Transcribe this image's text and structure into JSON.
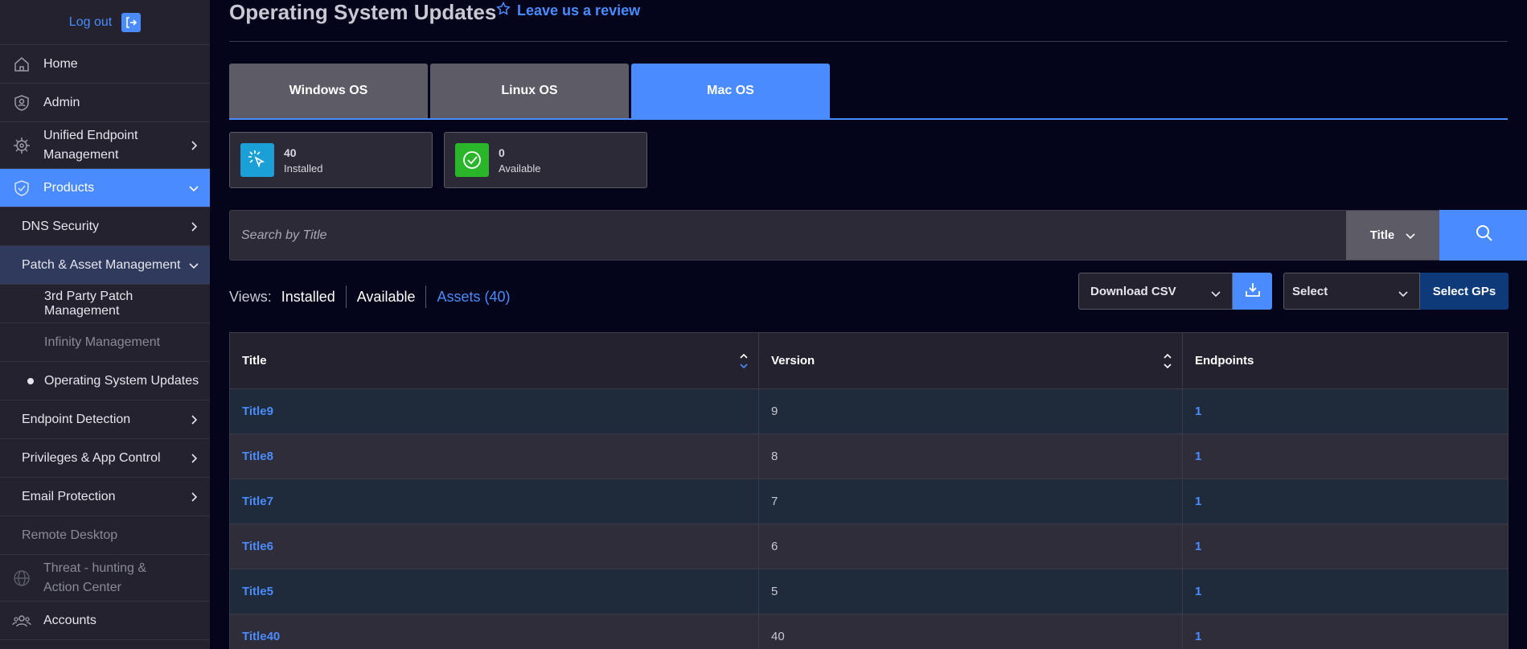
{
  "sidebar": {
    "logout_label": "Log out",
    "items": [
      {
        "label": "Home",
        "icon": "home-icon"
      },
      {
        "label": "Admin",
        "icon": "admin-icon"
      },
      {
        "label": "Unified Endpoint Management",
        "icon": "gear-icon"
      },
      {
        "label": "Products",
        "icon": "shield-icon"
      },
      {
        "label": "DNS Security"
      },
      {
        "label": "Patch & Asset Management"
      },
      {
        "label": "3rd Party Patch Management"
      },
      {
        "label": "Infinity Management"
      },
      {
        "label": "Operating System Updates"
      },
      {
        "label": "Endpoint Detection"
      },
      {
        "label": "Privileges & App Control"
      },
      {
        "label": "Email Protection"
      },
      {
        "label": "Remote Desktop"
      },
      {
        "label": "Threat - hunting & Action Center",
        "icon": "globe-icon"
      },
      {
        "label": "Accounts",
        "icon": "users-icon"
      }
    ]
  },
  "header": {
    "title": "Operating System Updates",
    "review_label": "Leave us a review"
  },
  "tabs": [
    {
      "label": "Windows OS"
    },
    {
      "label": "Linux OS"
    },
    {
      "label": "Mac OS"
    }
  ],
  "stats": {
    "installed": {
      "count": "40",
      "label": "Installed",
      "icon": "cursor-click-icon",
      "color": "#1a9fd6"
    },
    "available": {
      "count": "0",
      "label": "Available",
      "icon": "check-circle-icon",
      "color": "#2bb52b"
    }
  },
  "search": {
    "placeholder": "Search by Title",
    "field_select": "Title"
  },
  "views": {
    "label": "Views:",
    "installed": "Installed",
    "available": "Available",
    "assets": "Assets (40)"
  },
  "toolbar": {
    "download_label": "Download CSV",
    "select_label": "Select",
    "select_gps_label": "Select GPs"
  },
  "table": {
    "columns": [
      "Title",
      "Version",
      "Endpoints"
    ],
    "rows": [
      {
        "title": "Title9",
        "version": "9",
        "endpoints": "1"
      },
      {
        "title": "Title8",
        "version": "8",
        "endpoints": "1"
      },
      {
        "title": "Title7",
        "version": "7",
        "endpoints": "1"
      },
      {
        "title": "Title6",
        "version": "6",
        "endpoints": "1"
      },
      {
        "title": "Title5",
        "version": "5",
        "endpoints": "1"
      },
      {
        "title": "Title40",
        "version": "40",
        "endpoints": "1"
      }
    ]
  },
  "colors": {
    "accent": "#4a8cff",
    "sidebar_bg": "#23222e",
    "page_bg": "#04041a"
  }
}
